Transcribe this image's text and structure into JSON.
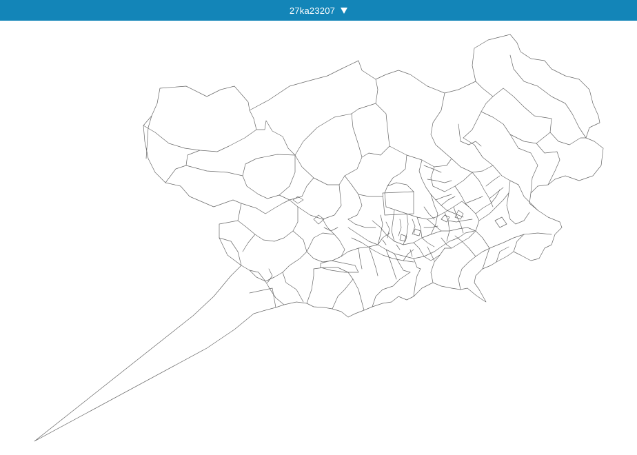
{
  "header": {
    "title": "27ka23207",
    "background": "#1385b8",
    "dropdown_icon": "caret-down-icon"
  },
  "map": {
    "stroke_color": "#666666",
    "background": "#ffffff"
  }
}
